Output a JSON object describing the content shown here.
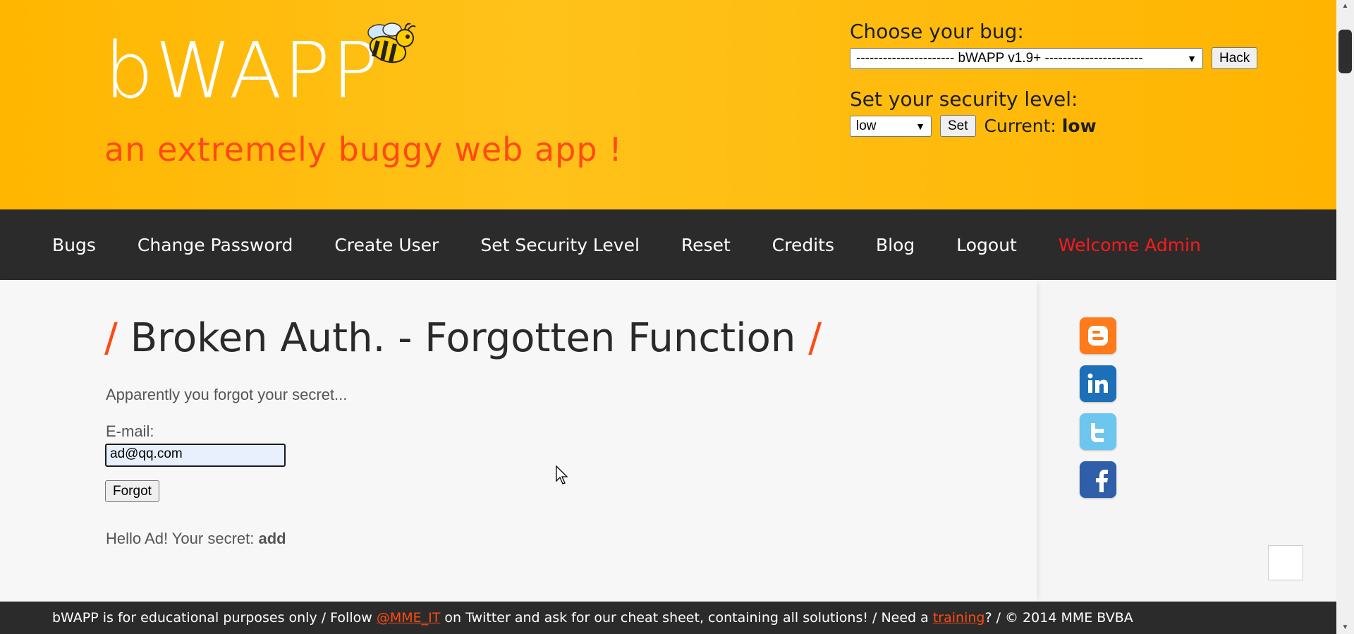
{
  "header": {
    "logo": "bWAPP",
    "tagline": "an extremely buggy web app !",
    "choose_bug_label": "Choose your bug:",
    "bug_select_value": "---------------------- bWAPP v1.9+ ----------------------",
    "hack_button": "Hack",
    "security_label": "Set your security level:",
    "security_select_value": "low",
    "set_button": "Set",
    "current_label": "Current:",
    "current_value": "low"
  },
  "nav": {
    "items": [
      "Bugs",
      "Change Password",
      "Create User",
      "Set Security Level",
      "Reset",
      "Credits",
      "Blog",
      "Logout"
    ],
    "welcome": "Welcome Admin"
  },
  "main": {
    "title_left_slash": "/",
    "title": "Broken Auth. - Forgotten Function",
    "title_right_slash": "/",
    "intro": "Apparently you forgot your secret...",
    "email_label": "E-mail:",
    "email_value": "ad@qq.com",
    "forgot_button": "Forgot",
    "result_prefix": "Hello Ad! Your secret:",
    "result_secret": "add"
  },
  "social": {
    "icons": [
      "blogger-icon",
      "linkedin-icon",
      "twitter-icon",
      "facebook-icon"
    ]
  },
  "footer": {
    "text_1": "bWAPP is for educational purposes only / Follow",
    "twitter_link": "@MME_IT",
    "text_2": "on Twitter and ask for our cheat sheet, containing all solutions! / Need a",
    "training_link": "training",
    "text_3": "? / © 2014 MME BVBA"
  },
  "colors": {
    "header_bg": "#ffb600",
    "accent_orange": "#ff4a14",
    "nav_bg": "#2b2b2b",
    "welcome_red": "#ff1a1a"
  }
}
